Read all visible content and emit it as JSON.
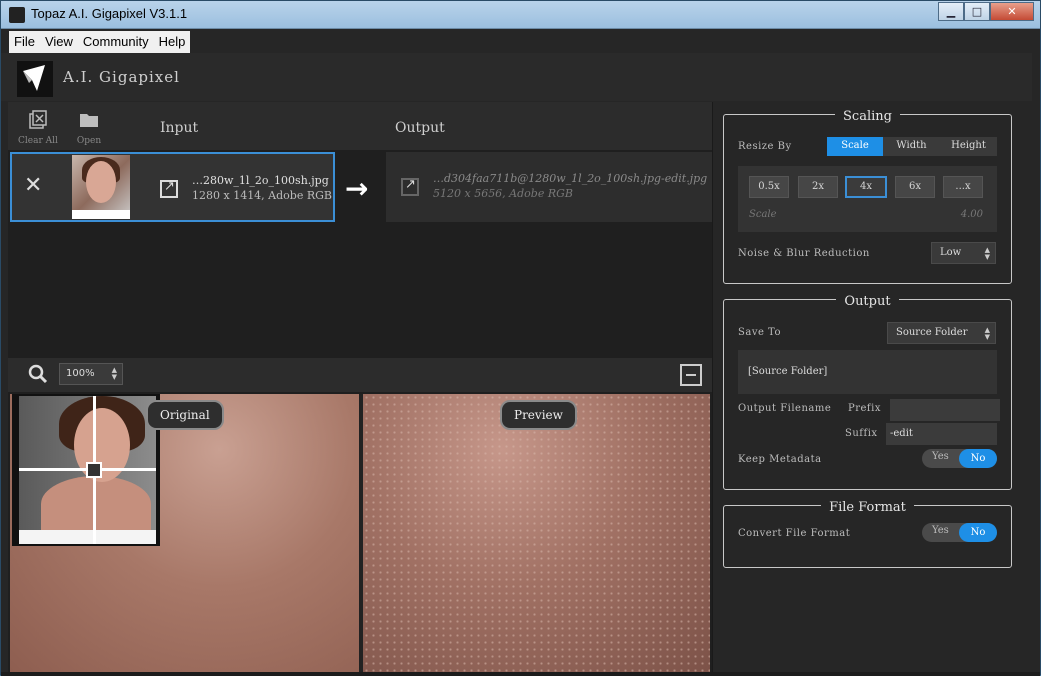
{
  "window": {
    "title": "Topaz A.I. Gigapixel V3.1.1",
    "min": "▁",
    "max": "□",
    "close": "✕"
  },
  "menu": [
    "File",
    "View",
    "Community",
    "Help"
  ],
  "brand": {
    "name": "A.I. Gigapixel"
  },
  "toolbar": {
    "clear_all": "Clear All",
    "open": "Open"
  },
  "columns": {
    "input": "Input",
    "output": "Output"
  },
  "input_file": {
    "name": "…280w_1l_2o_100sh.jpg",
    "meta": "1280 x 1414, Adobe RGB"
  },
  "output_file": {
    "name": "…d304faa711b@1280w_1l_2o_100sh.jpg-edit.jpg",
    "meta": "5120 x 5656, Adobe RGB"
  },
  "zoom": {
    "value": "100%"
  },
  "viewer": {
    "original_label": "Original",
    "preview_label": "Preview"
  },
  "scaling": {
    "title": "Scaling",
    "resize_by_label": "Resize By",
    "modes": [
      "Scale",
      "Width",
      "Height"
    ],
    "active_mode": "Scale",
    "scale_options": [
      "0.5x",
      "2x",
      "4x",
      "6x",
      "...x"
    ],
    "selected_scale": "4x",
    "scale_label": "Scale",
    "scale_value": "4.00",
    "noise_label": "Noise & Blur Reduction",
    "noise_value": "Low"
  },
  "output": {
    "title": "Output",
    "save_to_label": "Save To",
    "save_to_value": "Source Folder",
    "folder_path": "[Source Folder]",
    "filename_label": "Output Filename",
    "prefix_label": "Prefix",
    "prefix_value": "",
    "suffix_label": "Suffix",
    "suffix_value": "-edit",
    "metadata_label": "Keep Metadata",
    "yes": "Yes",
    "no": "No"
  },
  "file_format": {
    "title": "File Format",
    "convert_label": "Convert File Format",
    "yes": "Yes",
    "no": "No"
  },
  "colors": {
    "accent": "#1e8fe6",
    "panel": "#262626",
    "titlebar": "#b9d3ea"
  }
}
